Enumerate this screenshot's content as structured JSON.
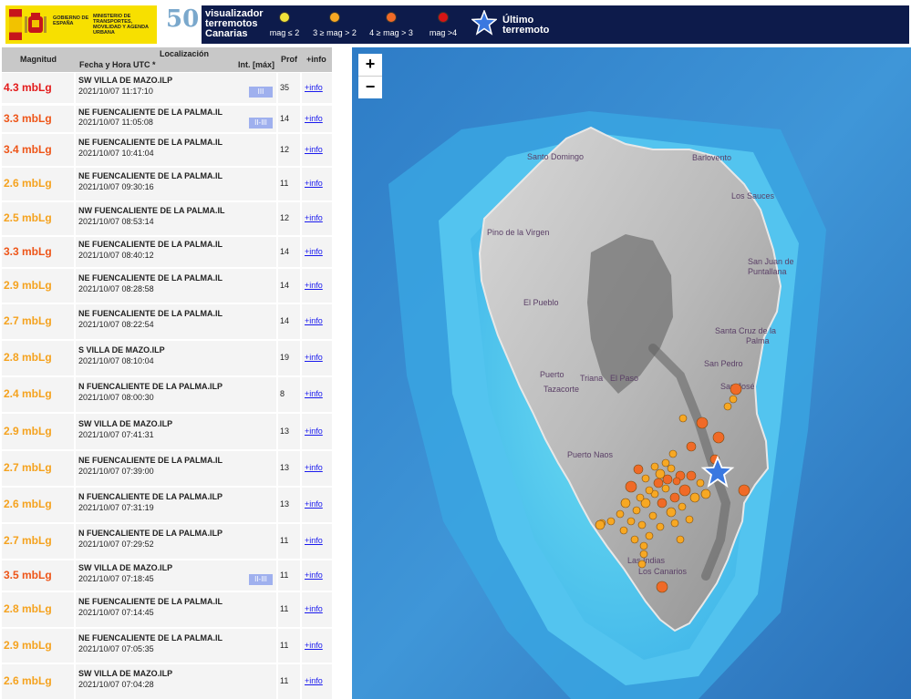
{
  "header": {
    "gov_text_1": "GOBIERNO DE ESPAÑA",
    "gov_text_2": "MINISTERIO DE TRANSPORTES, MOVILIDAD Y AGENDA URBANA",
    "anniv_number": "50",
    "app_title": "visualizador terremotos Canarias",
    "legend": [
      {
        "label": "mag ≤ 2",
        "color": "#f1e23a"
      },
      {
        "label": "3 ≥ mag > 2",
        "color": "#f7a823"
      },
      {
        "label": "4 ≥ mag > 3",
        "color": "#f06a27"
      },
      {
        "label": "mag >4",
        "color": "#d51515"
      }
    ],
    "last_quake_label": "Último terremoto"
  },
  "table": {
    "col_magnitude": "Magnitud",
    "col_location": "Localización",
    "col_datetime": "Fecha y Hora UTC *",
    "col_intensity": "Int. [máx]",
    "col_depth": "Prof",
    "col_info": "+info",
    "rows": [
      {
        "mag": "4.3 mbLg",
        "color": "#e31b1b",
        "loc": "SW VILLA DE MAZO.ILP",
        "dt": "2021/10/07 11:17:10",
        "int": "III",
        "prof": "35",
        "info": "+info"
      },
      {
        "mag": "3.3 mbLg",
        "color": "#ee5518",
        "loc": "NE FUENCALIENTE DE LA PALMA.IL",
        "dt": "2021/10/07 11:05:08",
        "int": "II-III",
        "prof": "14",
        "info": "+info"
      },
      {
        "mag": "3.4 mbLg",
        "color": "#ee5518",
        "loc": "NE FUENCALIENTE DE LA PALMA.IL",
        "dt": "2021/10/07 10:41:04",
        "int": "",
        "prof": "12",
        "info": "+info"
      },
      {
        "mag": "2.6 mbLg",
        "color": "#f5a21e",
        "loc": "NE FUENCALIENTE DE LA PALMA.IL",
        "dt": "2021/10/07 09:30:16",
        "int": "",
        "prof": "11",
        "info": "+info"
      },
      {
        "mag": "2.5 mbLg",
        "color": "#f5a21e",
        "loc": "NW FUENCALIENTE DE LA PALMA.IL",
        "dt": "2021/10/07 08:53:14",
        "int": "",
        "prof": "12",
        "info": "+info"
      },
      {
        "mag": "3.3 mbLg",
        "color": "#ee5518",
        "loc": "NE FUENCALIENTE DE LA PALMA.IL",
        "dt": "2021/10/07 08:40:12",
        "int": "",
        "prof": "14",
        "info": "+info"
      },
      {
        "mag": "2.9 mbLg",
        "color": "#f5a21e",
        "loc": "NE FUENCALIENTE DE LA PALMA.IL",
        "dt": "2021/10/07 08:28:58",
        "int": "",
        "prof": "14",
        "info": "+info"
      },
      {
        "mag": "2.7 mbLg",
        "color": "#f5a21e",
        "loc": "NE FUENCALIENTE DE LA PALMA.IL",
        "dt": "2021/10/07 08:22:54",
        "int": "",
        "prof": "14",
        "info": "+info"
      },
      {
        "mag": "2.8 mbLg",
        "color": "#f5a21e",
        "loc": "S VILLA DE MAZO.ILP",
        "dt": "2021/10/07 08:10:04",
        "int": "",
        "prof": "19",
        "info": "+info"
      },
      {
        "mag": "2.4 mbLg",
        "color": "#f5a21e",
        "loc": "N FUENCALIENTE DE LA PALMA.ILP",
        "dt": "2021/10/07 08:00:30",
        "int": "",
        "prof": "8",
        "info": "+info"
      },
      {
        "mag": "2.9 mbLg",
        "color": "#f5a21e",
        "loc": "SW VILLA DE MAZO.ILP",
        "dt": "2021/10/07 07:41:31",
        "int": "",
        "prof": "13",
        "info": "+info"
      },
      {
        "mag": "2.7 mbLg",
        "color": "#f5a21e",
        "loc": "NE FUENCALIENTE DE LA PALMA.IL",
        "dt": "2021/10/07 07:39:00",
        "int": "",
        "prof": "13",
        "info": "+info"
      },
      {
        "mag": "2.6 mbLg",
        "color": "#f5a21e",
        "loc": "N FUENCALIENTE DE LA PALMA.ILP",
        "dt": "2021/10/07 07:31:19",
        "int": "",
        "prof": "13",
        "info": "+info"
      },
      {
        "mag": "2.7 mbLg",
        "color": "#f5a21e",
        "loc": "N FUENCALIENTE DE LA PALMA.ILP",
        "dt": "2021/10/07 07:29:52",
        "int": "",
        "prof": "11",
        "info": "+info"
      },
      {
        "mag": "3.5 mbLg",
        "color": "#ee5518",
        "loc": "SW VILLA DE MAZO.ILP",
        "dt": "2021/10/07 07:18:45",
        "int": "II-III",
        "prof": "11",
        "info": "+info"
      },
      {
        "mag": "2.8 mbLg",
        "color": "#f5a21e",
        "loc": "NE FUENCALIENTE DE LA PALMA.IL",
        "dt": "2021/10/07 07:14:45",
        "int": "",
        "prof": "11",
        "info": "+info"
      },
      {
        "mag": "2.9 mbLg",
        "color": "#f5a21e",
        "loc": "NE FUENCALIENTE DE LA PALMA.IL",
        "dt": "2021/10/07 07:05:35",
        "int": "",
        "prof": "11",
        "info": "+info"
      },
      {
        "mag": "2.6 mbLg",
        "color": "#f5a21e",
        "loc": "SW VILLA DE MAZO.ILP",
        "dt": "2021/10/07 07:04:28",
        "int": "",
        "prof": "11",
        "info": "+info"
      }
    ]
  },
  "map": {
    "zoom_in": "+",
    "zoom_out": "−",
    "places": [
      "Santo Domingo",
      "Barlovento",
      "Los Sauces",
      "Pino de la Virgen",
      "San Juan de Puntallana",
      "El Pueblo",
      "Santa Cruz de la Palma",
      "San Pedro",
      "Puerto",
      "Tazacorte",
      "Triana",
      "El Paso",
      "San José",
      "Puerto Naos",
      "Las Indias",
      "Los Canarios"
    ]
  }
}
